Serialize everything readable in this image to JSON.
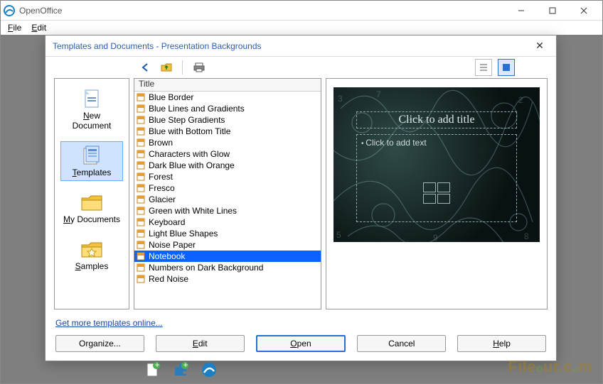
{
  "app": {
    "title": "OpenOffice"
  },
  "menubar": {
    "file": "File",
    "edit": "Edit"
  },
  "dialog": {
    "title": "Templates and Documents - Presentation Backgrounds",
    "link": "Get more templates online...",
    "buttons": {
      "organize": "Organize...",
      "edit": "Edit",
      "open": "Open",
      "cancel": "Cancel",
      "help": "Help"
    }
  },
  "nav": {
    "items": [
      {
        "label": "New Document",
        "icon": "doc"
      },
      {
        "label": "Templates",
        "icon": "template",
        "selected": true
      },
      {
        "label": "My Documents",
        "icon": "folder"
      },
      {
        "label": "Samples",
        "icon": "folder-star"
      }
    ]
  },
  "list": {
    "header": "Title",
    "selected_index": 14,
    "items": [
      "Blue Border",
      "Blue Lines and Gradients",
      "Blue Step Gradients",
      "Blue with Bottom Title",
      "Brown",
      "Characters with Glow",
      "Dark Blue with Orange",
      "Forest",
      "Fresco",
      "Glacier",
      "Green with White Lines",
      "Keyboard",
      "Light Blue Shapes",
      "Noise Paper",
      "Notebook",
      "Numbers on Dark Background",
      "Red Noise"
    ]
  },
  "preview": {
    "title": "Click to add title",
    "text": "Click to add text"
  },
  "watermark": "FileOur.com"
}
